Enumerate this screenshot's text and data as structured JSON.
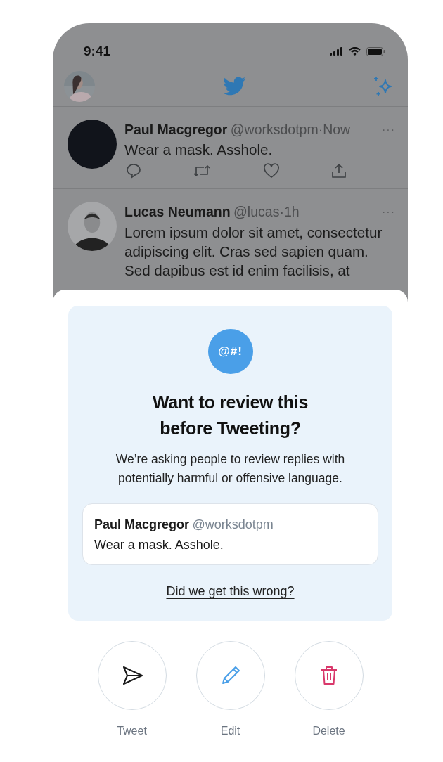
{
  "status_bar": {
    "time": "9:41"
  },
  "tweets": [
    {
      "avatar": {
        "kind": "blank"
      },
      "name": "Paul Macgregor",
      "meta": "@worksdotpm·Now",
      "more": "···",
      "text": "Wear a mask. Asshole.",
      "show_actions": true
    },
    {
      "name": "Lucas Neumann",
      "meta": "@lucas·1h",
      "more": "···",
      "text": "Lorem ipsum dolor sit amet, consectetur adipiscing elit. Cras sed sapien quam. Sed dapibus est id enim facilisis, at",
      "show_actions": false
    }
  ],
  "prompt": {
    "icon_text": "@#!",
    "title": "Want to review this before Tweeting?",
    "description": "We’re asking people to review replies with potentially harmful or offensive language.",
    "quoted": {
      "name": "Paul Macgregor",
      "handle": "@worksdotpm",
      "text": "Wear a mask. Asshole."
    },
    "link": "Did we get this wrong?"
  },
  "actions": [
    {
      "kind": "send",
      "label": "Tweet"
    },
    {
      "kind": "edit",
      "label": "Edit"
    },
    {
      "kind": "delete",
      "label": "Delete"
    }
  ]
}
